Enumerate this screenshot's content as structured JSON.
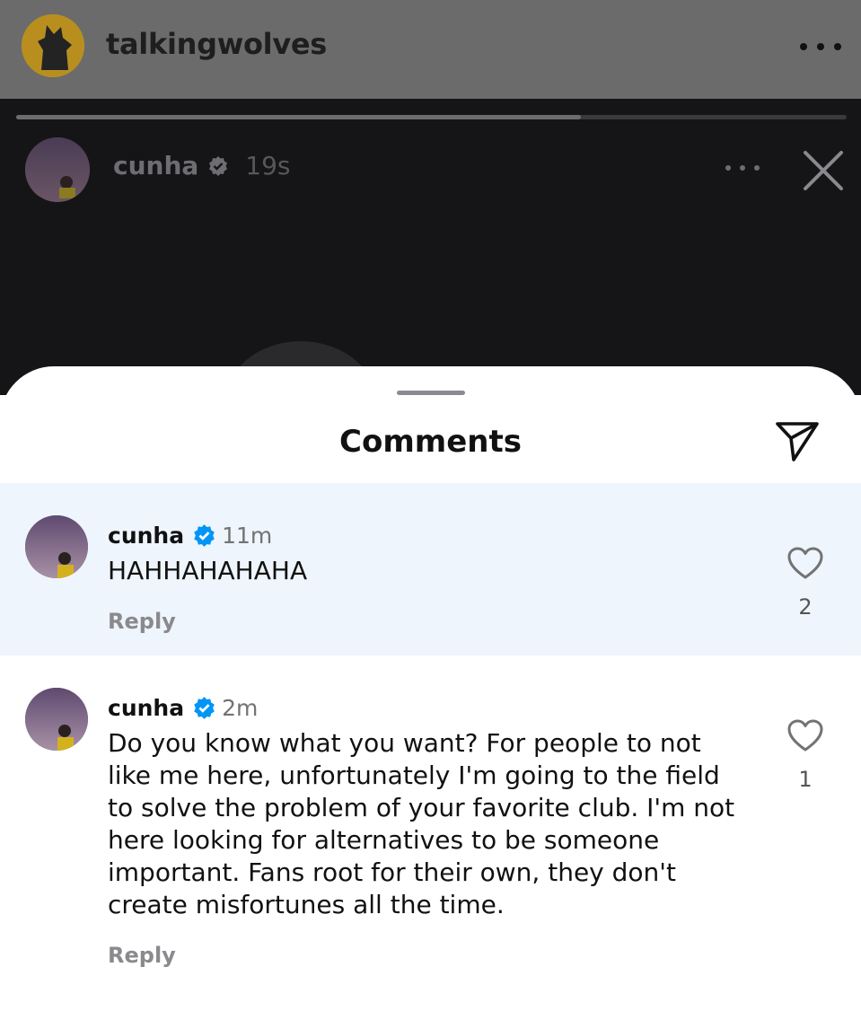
{
  "header": {
    "account_name": "talkingwolves",
    "more_icon": "more-horizontal-icon"
  },
  "story": {
    "username": "cunha",
    "time": "19s",
    "progress": 0.68
  },
  "comments_sheet": {
    "title": "Comments",
    "share_icon": "paper-plane-icon",
    "comments": [
      {
        "username": "cunha",
        "time": "11m",
        "text": "HAHHAHAHAHA",
        "reply_label": "Reply",
        "likes": "2",
        "highlighted": true
      },
      {
        "username": "cunha",
        "time": "2m",
        "text": "Do you know what you want? For people to not\nlike me here, unfortunately I'm going to the field\nto solve the problem of your favorite club. I'm not\nhere looking for alternatives to be someone\nimportant. Fans root for their own, they don't\ncreate misfortunes all the time.",
        "reply_label": "Reply",
        "likes": "1",
        "highlighted": false
      }
    ]
  },
  "colors": {
    "verified_blue": "#0095f6",
    "highlight_bg": "#eef5fc",
    "wolves_gold": "#b88f1f"
  }
}
